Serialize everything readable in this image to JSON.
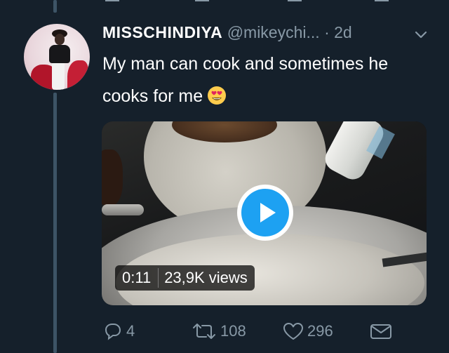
{
  "tweet": {
    "display_name": "MISSCHINDIYA",
    "handle": "@mikeychi...",
    "separator": "·",
    "time": "2d",
    "text": "My man can cook and sometimes he cooks for me",
    "emoji": "heart-eyes"
  },
  "video": {
    "duration": "0:11",
    "views": "23,9K views"
  },
  "actions": {
    "reply_count": "4",
    "retweet_count": "108",
    "like_count": "296"
  },
  "colors": {
    "background": "#15202b",
    "secondary_text": "#8899a6",
    "accent": "#1da1f2"
  }
}
